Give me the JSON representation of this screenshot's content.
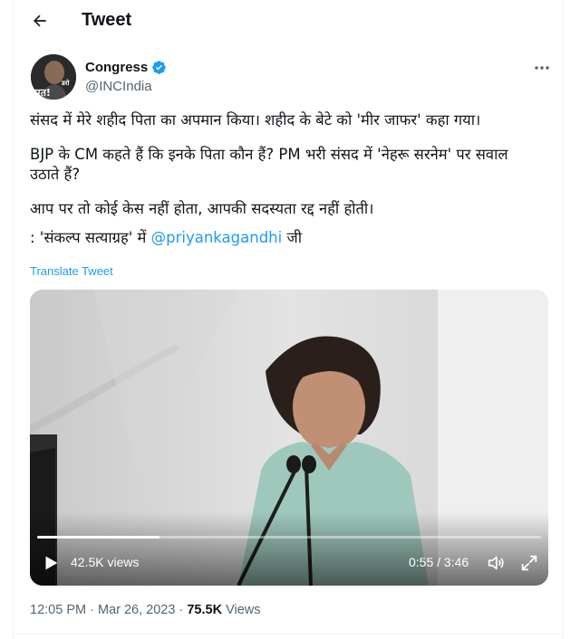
{
  "header": {
    "title": "Tweet"
  },
  "author": {
    "name": "Congress",
    "handle": "@INCIndia",
    "avatar_text_top": "डरो",
    "avatar_text_bottom": "मत!",
    "verified_color": "#1d9bf0"
  },
  "tweet": {
    "line1": "संसद में मेरे शहीद पिता का अपमान किया। शहीद के बेटे को 'मीर जाफर' कहा गया।",
    "line2": "BJP के CM कहते हैं कि इनके पिता कौन हैं? PM भरी संसद में 'नेहरू सरनेम' पर सवाल उठाते हैं?",
    "line3": "आप पर तो कोई केस नहीं होता, आपकी सदस्यता रद्द नहीं होती।",
    "line4_prefix": ": 'संकल्प सत्याग्रह' में ",
    "line4_mention": "@priyankagandhi",
    "line4_suffix": " जी",
    "translate_label": "Translate Tweet"
  },
  "video": {
    "views_label": "42.5K views",
    "time_label": "0:55 / 3:46",
    "progress_fraction": 0.243
  },
  "meta": {
    "time": "12:05 PM",
    "separator": "·",
    "date": "Mar 26, 2023",
    "views_count": "75.5K",
    "views_label": "Views"
  },
  "colors": {
    "accent": "#1d9bf0",
    "text": "#0f1419",
    "secondary": "#536471"
  }
}
